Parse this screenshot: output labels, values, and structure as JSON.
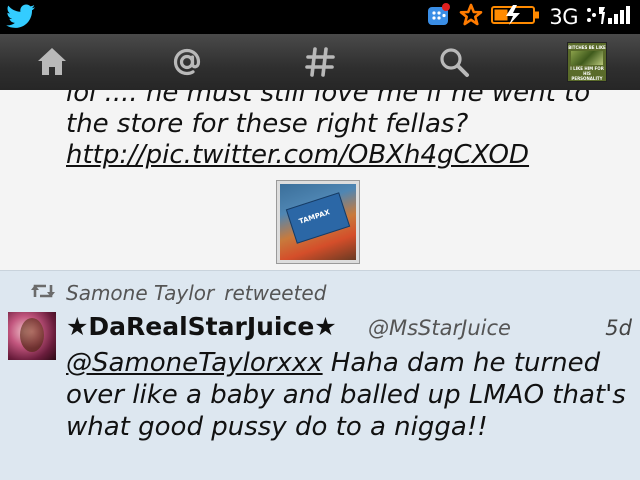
{
  "status_bar": {
    "network": "3G",
    "icons": [
      "twitter-bird-icon",
      "blackberry-messenger-icon",
      "favorite-star-icon",
      "battery-charging-icon",
      "signal-icon"
    ]
  },
  "nav": {
    "items": [
      {
        "name": "home",
        "icon": "home-icon"
      },
      {
        "name": "mentions",
        "icon": "at-icon"
      },
      {
        "name": "hashtags",
        "icon": "hashtag-icon"
      },
      {
        "name": "search",
        "icon": "search-icon"
      }
    ],
    "profile_avatar": {
      "top_text": "BITCHES BE LIKE",
      "bottom_text": "I LIKE HIM FOR HIS PERSONALITY"
    }
  },
  "tweet1": {
    "text": "lol .... he must still love me if he went to the store for these right fellas? ",
    "link": "http://pic.twitter.com/OBXh4gCXOD",
    "thumbnail_label": "TAMPAX"
  },
  "tweet2": {
    "retweeted_by": "Samone Taylor",
    "retweeted_label": "retweeted",
    "display_name": "★DaRealStarJuice★",
    "handle": "@MsStarJuice",
    "time": "5d",
    "mention": "@SamoneTaylorxxx",
    "text": " Haha dam he turned over like a baby and balled up LMAO that's what good pussy do to a nigga!!"
  },
  "colors": {
    "status_bg": "#000000",
    "nav_bg": "#333333",
    "tweet_bg": "#f4f4f4",
    "selected_bg": "#dde7f0",
    "twitter_blue": "#33ccff",
    "bbm_blue": "#3a8ee6",
    "star_orange": "#ff7b00"
  }
}
